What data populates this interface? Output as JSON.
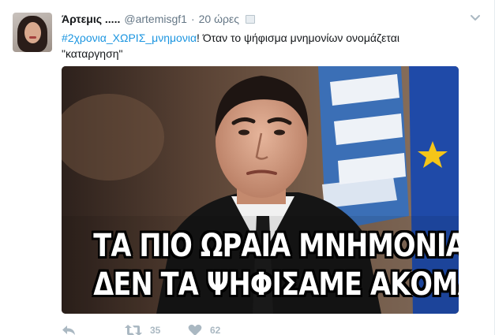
{
  "tweet": {
    "fullname": "Άρτεμις .....",
    "username": "@artemisgf1",
    "separator": "·",
    "time": "20 ώρες",
    "hashtag": "#2χρονια_ΧΩΡΙΣ_μνημονια",
    "text_rest": "! Όταν το ψήφισμα μνημονίων ονομάζεται \"καταργηση\"",
    "image": {
      "caption_line1": "ΤΑ ΠΙΟ ΩΡΑΙΑ ΜΝΗΜΟΝΙΑ",
      "caption_line2": "ΔΕΝ ΤΑ ΨΗΦΙΣΑΜΕ ΑΚΟΜΑ"
    },
    "actions": {
      "retweet_count": "35",
      "like_count": "62"
    }
  },
  "icons": {
    "caret": "chevron-down-icon",
    "reply": "reply-icon",
    "retweet": "retweet-icon",
    "like": "heart-icon",
    "flag": "translate-flag-icon"
  },
  "colors": {
    "link": "#1b95e0",
    "muted": "#657786",
    "action": "#aab8c2",
    "text": "#14171a"
  }
}
